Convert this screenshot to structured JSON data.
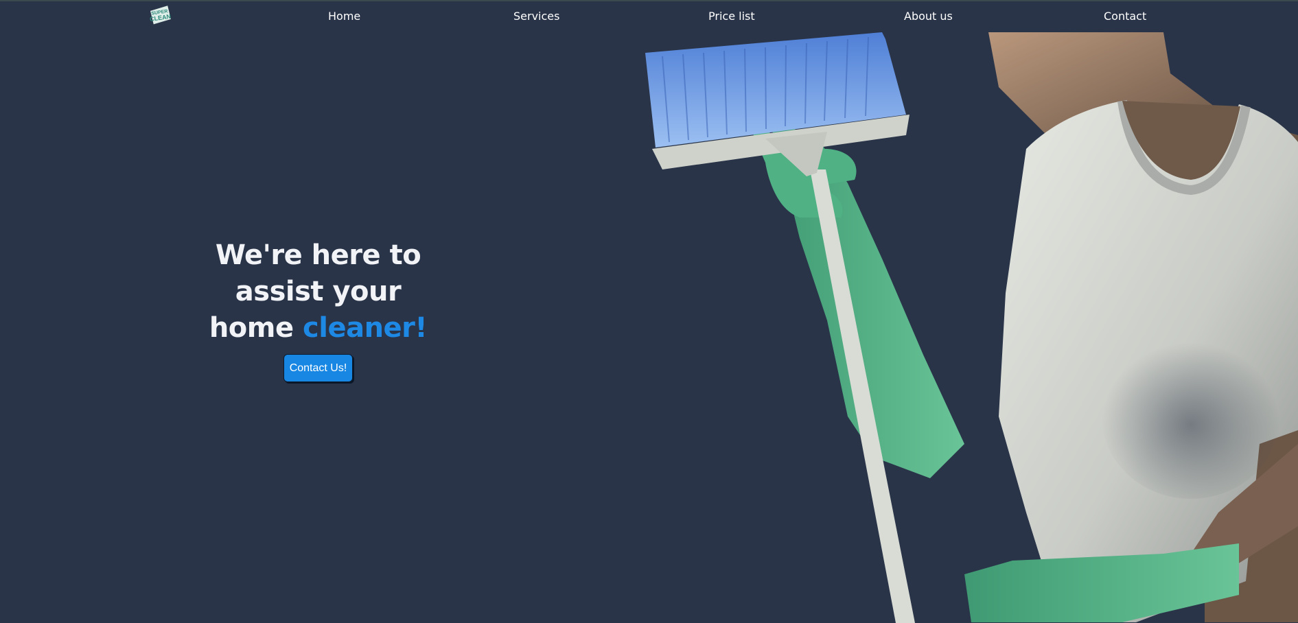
{
  "logo": {
    "line1": "SUPER",
    "line2": "CLEAN"
  },
  "nav": {
    "items": [
      {
        "label": "Home"
      },
      {
        "label": "Services"
      },
      {
        "label": "Price list"
      },
      {
        "label": "About us"
      },
      {
        "label": "Contact"
      }
    ]
  },
  "hero": {
    "headline_line1": "We're here to",
    "headline_line2": "assist your",
    "headline_line3_pre": "home ",
    "headline_accent": "cleaner!",
    "cta_label": "Contact Us!"
  },
  "colors": {
    "background": "#293449",
    "accent": "#1e88e5",
    "button": "#1787e3",
    "text": "#ffffff"
  }
}
